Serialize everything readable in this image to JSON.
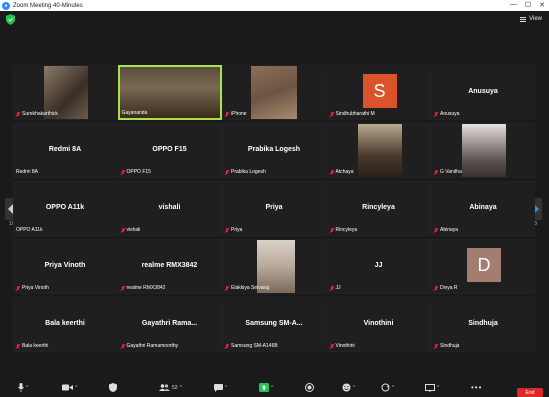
{
  "window": {
    "title": "Zoom Meeting 40-Minutes",
    "app_icon": "zoom-icon"
  },
  "topbar": {
    "view_label": "View"
  },
  "pagination": {
    "left": "1/3",
    "right": "1/3"
  },
  "tiles": [
    {
      "name": "Surekhakarthick",
      "type": "video",
      "muted": true
    },
    {
      "name": "Gayananda",
      "type": "video",
      "muted": false,
      "active": true
    },
    {
      "name": "iPhone",
      "type": "video",
      "muted": true
    },
    {
      "name": "Sindhubharathi M",
      "type": "avatar",
      "initial": "S",
      "avatar_color": "#d9542b",
      "muted": true
    },
    {
      "name": "Anusuya",
      "type": "name",
      "display": "Anusuya",
      "muted": true
    },
    {
      "name": "Redmi 8A",
      "type": "name",
      "display": "Redmi 8A",
      "muted": false
    },
    {
      "name": "OPPO F15",
      "type": "name",
      "display": "OPPO F15",
      "muted": true
    },
    {
      "name": "Prabika Logesh",
      "type": "name",
      "display": "Prabika Logesh",
      "muted": true
    },
    {
      "name": "Atchaya",
      "type": "video",
      "muted": true
    },
    {
      "name": "G Vanitha",
      "type": "video",
      "muted": true
    },
    {
      "name": "OPPO A11k",
      "type": "name",
      "display": "OPPO A11k",
      "muted": false
    },
    {
      "name": "vishali",
      "type": "name",
      "display": "vishali",
      "muted": true
    },
    {
      "name": "Priya",
      "type": "name",
      "display": "Priya",
      "muted": true
    },
    {
      "name": "Rincyleya",
      "type": "name",
      "display": "Rincyleya",
      "muted": true
    },
    {
      "name": "Abinaya",
      "type": "name",
      "display": "Abinaya",
      "muted": true
    },
    {
      "name": "Priya Vinoth",
      "type": "name",
      "display": "Priya Vinoth",
      "muted": true
    },
    {
      "name": "realme RMX3842",
      "type": "name",
      "display": "realme RMX3842",
      "muted": true
    },
    {
      "name": "Elakkiya Selvaraj",
      "type": "video",
      "muted": true
    },
    {
      "name": "JJ",
      "type": "name",
      "display": "JJ",
      "muted": true
    },
    {
      "name": "Divya R",
      "type": "avatar",
      "initial": "D",
      "avatar_color": "#a37d6f",
      "muted": true
    },
    {
      "name": "Bala keerthi",
      "type": "name",
      "display": "Bala keerthi",
      "muted": true
    },
    {
      "name": "Gayathri Ramamoorthy",
      "type": "name",
      "display": "Gayathri  Rama...",
      "muted": true
    },
    {
      "name": "Samsung SM-A146B",
      "type": "name",
      "display": "Samsung  SM-A...",
      "muted": true
    },
    {
      "name": "Vinothini",
      "type": "name",
      "display": "Vinothini",
      "muted": true
    },
    {
      "name": "Sindhuja",
      "type": "name",
      "display": "Sindhuja",
      "muted": true
    }
  ],
  "toolbar": {
    "participants_count": "52",
    "end_label": "End"
  },
  "colors": {
    "active_border": "#a6e34a",
    "end_red": "#e02828",
    "nav_blue": "#2d8cff",
    "share_green": "#23c552"
  }
}
